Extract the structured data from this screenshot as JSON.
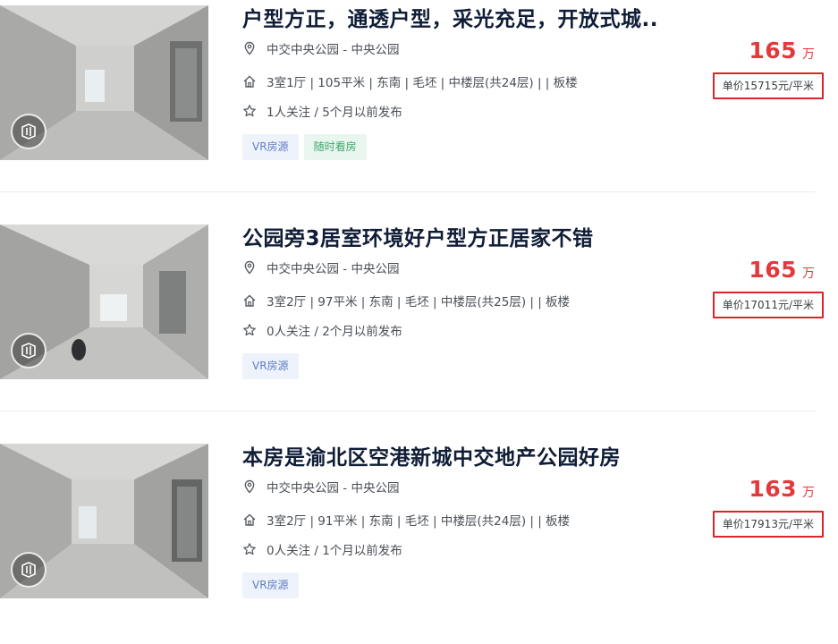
{
  "listings": [
    {
      "title": "户型方正，通透户型，采光充足，开放式城..",
      "location": "中交中央公园 - 中央公园",
      "house_info": "3室1厅 | 105平米 | 东南 | 毛坯 | 中楼层(共24层) | | 板楼",
      "follow_info": "1人关注 / 5个月以前发布",
      "tags": [
        "VR房源",
        "随时看房"
      ],
      "total_price": "165",
      "price_unit": "万",
      "unit_price": "单价15715元/平米"
    },
    {
      "title": "公园旁3居室环境好户型方正居家不错",
      "location": "中交中央公园 - 中央公园",
      "house_info": "3室2厅 | 97平米 | 东南 | 毛坯 | 中楼层(共25层) | | 板楼",
      "follow_info": "0人关注 / 2个月以前发布",
      "tags": [
        "VR房源"
      ],
      "total_price": "165",
      "price_unit": "万",
      "unit_price": "单价17011元/平米"
    },
    {
      "title": "本房是渝北区空港新城中交地产公园好房",
      "location": "中交中央公园 - 中央公园",
      "house_info": "3室2厅 | 91平米 | 东南 | 毛坯 | 中楼层(共24层) | | 板楼",
      "follow_info": "0人关注 / 1个月以前发布",
      "tags": [
        "VR房源"
      ],
      "total_price": "163",
      "price_unit": "万",
      "unit_price": "单价17913元/平米"
    }
  ],
  "colors": {
    "price": "#e4393c",
    "highlight_box": "#d8262c",
    "tag_vr_bg": "#eef2fb",
    "tag_vr_text": "#5f7ec2",
    "tag_visit_bg": "#e9f6ef",
    "tag_visit_text": "#3aa86b"
  },
  "icons": {
    "location": "location-pin-icon",
    "house": "house-icon",
    "follow": "star-icon",
    "vr": "vr-cube-icon"
  }
}
